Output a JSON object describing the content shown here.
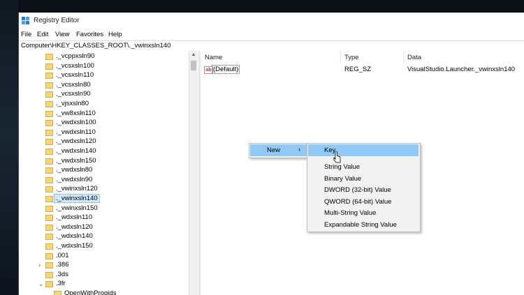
{
  "window": {
    "title": "Registry Editor"
  },
  "menu": [
    "File",
    "Edit",
    "View",
    "Favorites",
    "Help"
  ],
  "address": "Computer\\HKEY_CLASSES_ROOT\\._vwinxsln140",
  "tree": [
    {
      "label": "._vcppxsln90"
    },
    {
      "label": "._vcsxsln100"
    },
    {
      "label": "._vcsxsln110"
    },
    {
      "label": "._vcsxsln80"
    },
    {
      "label": "._vcsxsln90"
    },
    {
      "label": "._vjsxsln80"
    },
    {
      "label": "._vw8xsln110"
    },
    {
      "label": "._vwdxsln100"
    },
    {
      "label": "._vwdxsln110"
    },
    {
      "label": "._vwdxsln120"
    },
    {
      "label": "._vwdxsln140"
    },
    {
      "label": "._vwdxsln150"
    },
    {
      "label": "._vwdxsln80"
    },
    {
      "label": "._vwdxsln90"
    },
    {
      "label": "._vwinxsln120"
    },
    {
      "label": "._vwinxsln140",
      "selected": true
    },
    {
      "label": "._vwinxsln150"
    },
    {
      "label": "._wdxsln110"
    },
    {
      "label": "._wdxsln120"
    },
    {
      "label": "._wdxsln140"
    },
    {
      "label": "._wdxsln150"
    },
    {
      "label": ".001"
    },
    {
      "label": ".386",
      "expander": "›"
    },
    {
      "label": ".3ds"
    },
    {
      "label": ".3fr",
      "expander": "⌄"
    },
    {
      "label": "OpenWithProgids",
      "child": true
    }
  ],
  "columns": {
    "name": "Name",
    "type": "Type",
    "data": "Data"
  },
  "values": [
    {
      "name": "(Default)",
      "type": "REG_SZ",
      "data": "VisualStudio.Launcher._vwinxsln140"
    }
  ],
  "context_menu": {
    "new_label": "New",
    "arrow": "›"
  },
  "submenu": [
    "Key",
    "String Value",
    "Binary Value",
    "DWORD (32-bit) Value",
    "QWORD (64-bit) Value",
    "Multi-String Value",
    "Expandable String Value"
  ],
  "colors": {
    "highlight": "#91c9f7",
    "selection": "#cde8ff",
    "folder": "#f5d57a"
  }
}
